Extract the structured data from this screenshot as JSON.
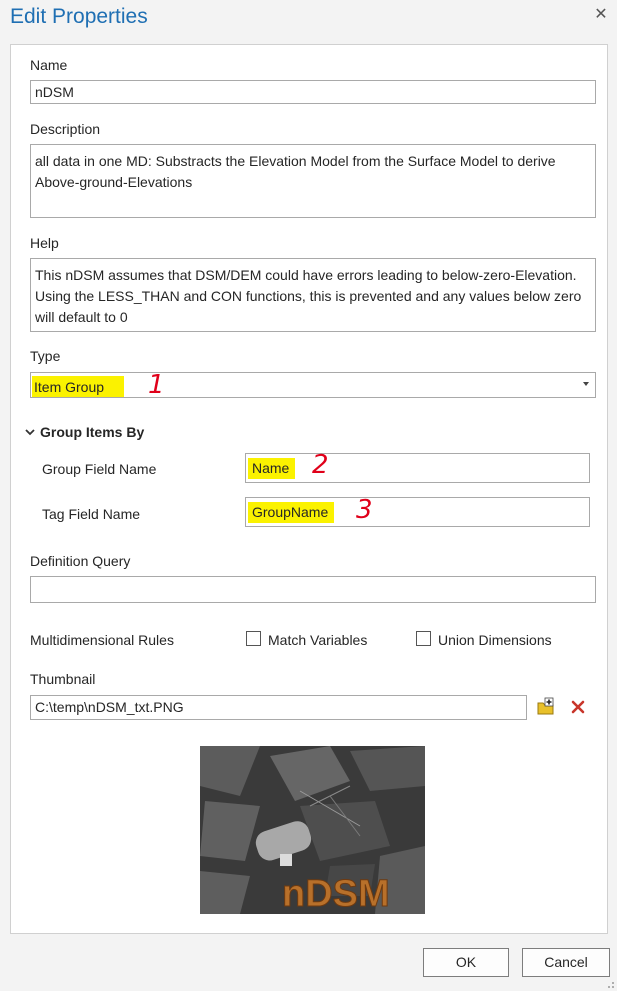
{
  "window": {
    "title": "Edit Properties",
    "close_glyph": "✕"
  },
  "fields": {
    "name": {
      "label": "Name",
      "value": "nDSM"
    },
    "description": {
      "label": "Description",
      "value": "all data in one MD: Substracts the Elevation Model from the Surface Model to derive Above-ground-Elevations"
    },
    "help": {
      "label": "Help",
      "value": "This nDSM assumes that DSM/DEM could have errors leading to below-zero-Elevation. Using the LESS_THAN and CON functions, this is prevented and any values below zero will default to 0"
    },
    "type": {
      "label": "Type",
      "value": "Item Group"
    },
    "group_items_by": {
      "header": "Group Items By",
      "group_field_name": {
        "label": "Group Field Name",
        "value": "Name"
      },
      "tag_field_name": {
        "label": "Tag Field Name",
        "value": "GroupName"
      }
    },
    "definition_query": {
      "label": "Definition Query",
      "value": ""
    },
    "multidimensional_rules": {
      "label": "Multidimensional Rules",
      "match_variables": {
        "label": "Match Variables",
        "checked": false
      },
      "union_dimensions": {
        "label": "Union Dimensions",
        "checked": false
      }
    },
    "thumbnail": {
      "label": "Thumbnail",
      "path": "C:\\temp\\nDSM_txt.PNG",
      "preview_text": "nDSM"
    }
  },
  "annotations": [
    "1",
    "2",
    "3"
  ],
  "buttons": {
    "ok": "OK",
    "cancel": "Cancel"
  },
  "icons": {
    "close": "close-icon",
    "chevron": "chevron-down-icon",
    "dropdown": "dropdown-arrow-icon",
    "browse": "browse-folder-icon",
    "clear": "clear-x-icon",
    "grip": "resize-grip-icon"
  },
  "colors": {
    "title": "#1f6fb3",
    "highlight": "#fbf200",
    "annotation": "#e0001a",
    "clear_icon": "#c8352a"
  }
}
